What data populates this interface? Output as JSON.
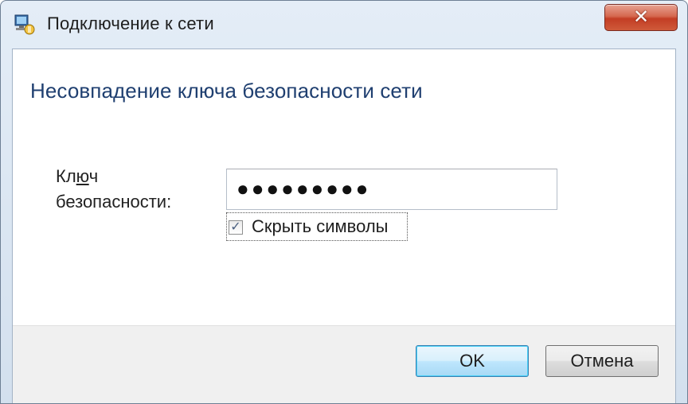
{
  "window": {
    "title": "Подключение к сети",
    "icon": "network-connection-icon",
    "close_glyph": "✕"
  },
  "main": {
    "heading": "Несовпадение ключа безопасности сети",
    "key_label_line1_prefix": "Кл",
    "key_label_line1_mnemonic": "ю",
    "key_label_line1_suffix": "ч",
    "key_label_line2": "безопасности:",
    "password_value": "●●●●●●●●●",
    "hide_chars_checked": true,
    "hide_chars_mark": "✓",
    "hide_chars_label": "Скрыть символы"
  },
  "buttons": {
    "ok_label": "OK",
    "cancel_label": "Отмена"
  },
  "colors": {
    "heading": "#1f3f70",
    "close_button": "#c33d24",
    "default_button_border": "#3c7fb1"
  }
}
